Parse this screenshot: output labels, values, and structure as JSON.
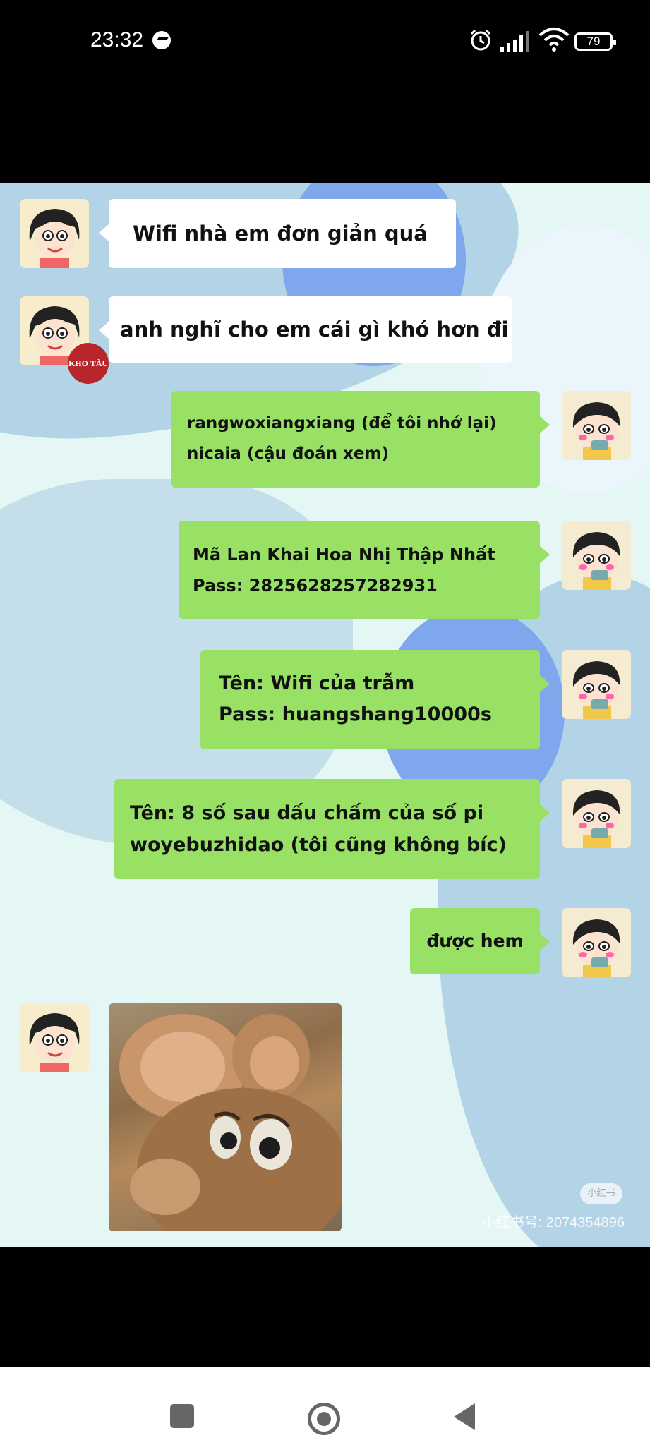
{
  "status_bar": {
    "time": "23:32",
    "battery": "79",
    "icons": [
      "messenger-icon",
      "alarm-icon",
      "signal-icon",
      "wifi-icon",
      "battery-icon"
    ]
  },
  "messages": [
    {
      "sender": "left",
      "lines": [
        "Wifi nhà em đơn giản quá"
      ]
    },
    {
      "sender": "left",
      "lines": [
        "anh nghĩ cho em cái gì khó hơn đi"
      ]
    },
    {
      "sender": "right",
      "lines": [
        "rangwoxiangxiang (để tôi nhớ lại)",
        "nicaia (cậu đoán xem)"
      ]
    },
    {
      "sender": "right",
      "lines": [
        "Mã Lan Khai Hoa Nhị Thập Nhất",
        "Pass: 2825628257282931"
      ]
    },
    {
      "sender": "right",
      "lines": [
        "Tên: Wifi của trẫm",
        "Pass: huangshang10000s"
      ]
    },
    {
      "sender": "right",
      "lines": [
        "Tên: 8 số sau dấu chấm của số pi",
        "woyebuzhidao (tôi cũng không bíc)"
      ]
    },
    {
      "sender": "right",
      "lines": [
        "được hem"
      ]
    }
  ],
  "stamp_text": "KHO TÀU",
  "watermark": {
    "badge": "小红书",
    "id": "小红书号: 2074354896"
  },
  "colors": {
    "right_bubble": "#98e165",
    "left_bubble": "#ffffff",
    "chat_background": "#e4f7f4",
    "accent_blue": "#7ea7ee"
  },
  "nav": [
    "recents-button",
    "home-button",
    "back-button"
  ]
}
